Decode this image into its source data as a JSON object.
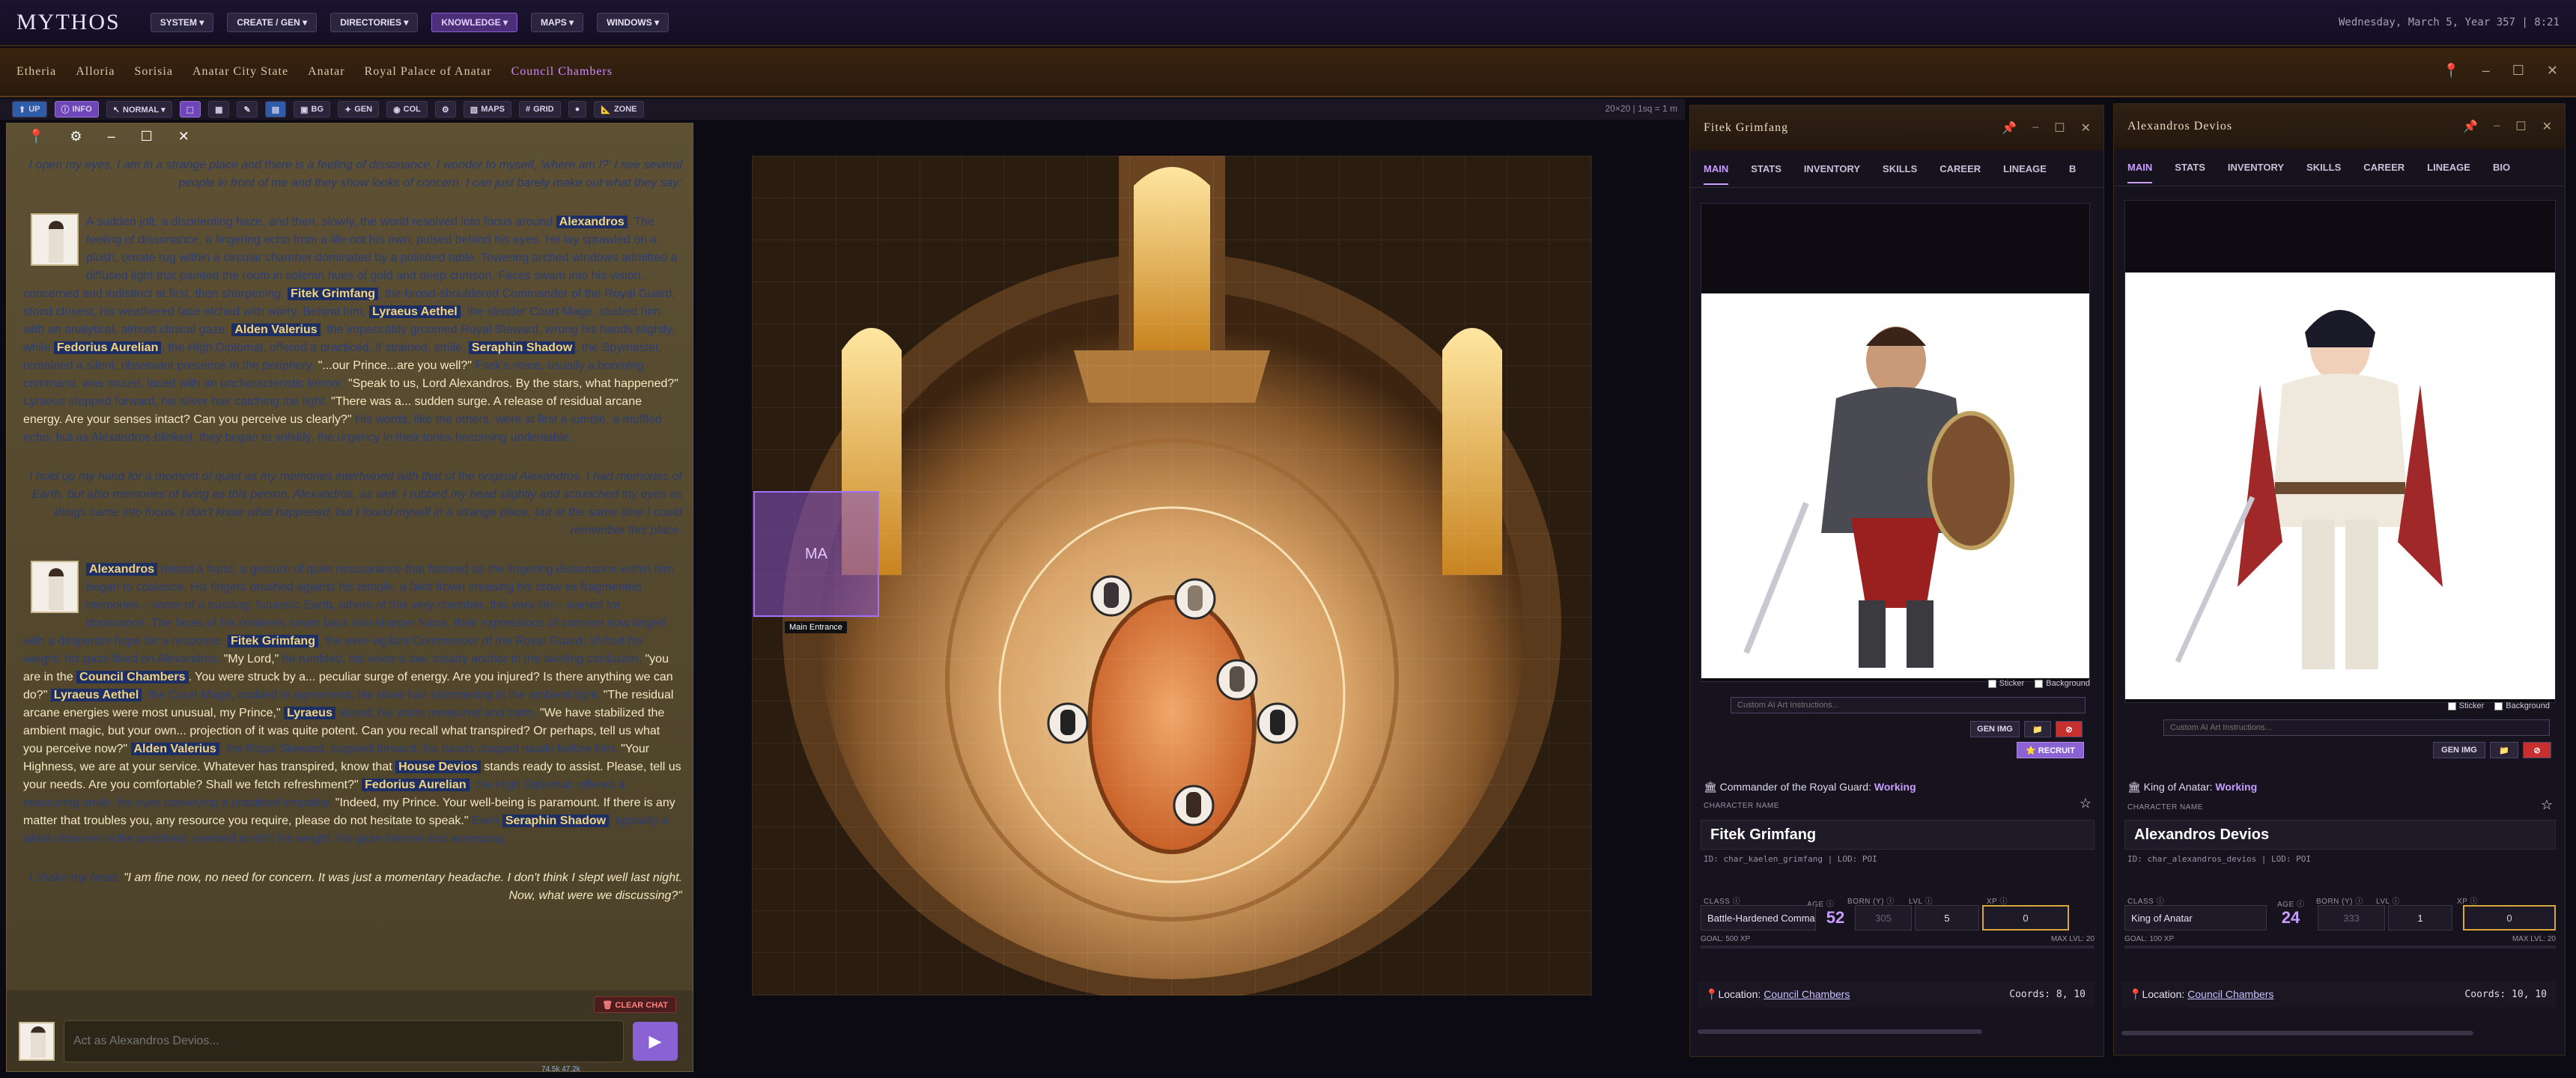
{
  "app": {
    "logo": "MYTHOS",
    "datetime": "Wednesday, March 5, Year 357 | 8:21"
  },
  "menu": [
    {
      "label": "SYSTEM ▾"
    },
    {
      "label": "CREATE / GEN ▾"
    },
    {
      "label": "DIRECTORIES ▾"
    },
    {
      "label": "KNOWLEDGE ▾"
    },
    {
      "label": "MAPS ▾"
    },
    {
      "label": "WINDOWS ▾"
    }
  ],
  "breadcrumb": [
    "Etheria",
    "Alloria",
    "Sorisia",
    "Anatar City State",
    "Anatar",
    "Royal Palace of Anatar",
    "Council Chambers"
  ],
  "toolbar": {
    "up": "UP",
    "info": "INFO",
    "mode": "NORMAL ▾",
    "bg": "BG",
    "gen": "GEN",
    "col": "COL",
    "maps": "MAPS",
    "grid": "GRID",
    "zone": "ZONE",
    "gridinfo": "20×20 | 1sq = 1 m"
  },
  "chat": {
    "narr1": "I open my eyes, I am in a strange place and there is a feeling of dissonance. I wonder to myself, 'where am I?' I see several people in front of me and they show looks of concern. I can just barely make out what they say:",
    "m1": {
      "t1": "A sudden jolt, a disorienting haze, and then, slowly, the world resolved into focus around ",
      "n1": "Alexandros",
      "t2": ". The feeling of dissonance, a lingering echo from a life not his own, pulsed behind his eyes. He lay sprawled on a plush, ornate rug within a circular chamber dominated by a polished table. Towering arched windows admitted a diffused light that painted the room in solemn hues of gold and deep crimson. Faces swam into his vision, concerned and indistinct at first, then sharpening. ",
      "n2": "Fitek Grimfang",
      "t3": ", the broad-shouldered Commander of the Royal Guard, stood closest, his weathered face etched with worry. Behind him, ",
      "n3": "Lyraeus Aethel",
      "t4": ", the slender Court Mage, studied him with an analytical, almost clinical gaze. ",
      "n4": "Alden Valerius",
      "t5": ", the impeccably groomed Royal Steward, wrung his hands slightly, while ",
      "n5": "Fedorius Aurelian",
      "t6": ", the High Diplomat, offered a practiced, if strained, smile. ",
      "n6": "Seraphin Shadow",
      "t7": ", the Spymaster, remained a silent, observant presence in the periphery. ",
      "q1": "\"...our Prince...are you well?\"",
      "t8": " Fitek's voice, usually a booming command, was muted, laced with an uncharacteristic tremor. ",
      "q2": "\"Speak to us, Lord Alexandros. By the stars, what happened?\"",
      "t9": " Lyraeus stepped forward, his silver hair catching the light. ",
      "q3": "\"There was a... sudden surge. A release of residual arcane energy. Are your senses intact? Can you perceive us clearly?\"",
      "t10": " His words, like the others, were at first a jumble, a muffled echo, but as Alexandros blinked, they began to solidify, the urgency in their tones becoming undeniable."
    },
    "narr2": "I hold up my hand for a moment of quiet as my memories intertwined with that of the original Alexandros. I had memories of Earth, but also memories of living as this person, Alexandros, as well. I rubbed my head slightly and scrunched my eyes as things came into focus. I don't know what happened, but I found myself in a strange place, but at the same time I could remember this place.",
    "m2": {
      "n1": "Alexandros",
      "t1": " raised a hand, a gesture of quiet reassurance that faltered as the lingering dissonance within him began to coalesce. His fingers brushed against his temple, a faint frown creasing his brow as fragmented memories – some of a bustling, futuristic Earth, others of this very chamber, this very life – warred for dominance. The faces of his retainers swam back into sharper focus, their expressions of concern now tinged with a desperate hope for a response. ",
      "n2": "Fitek Grimfang",
      "t2": ", the ever-vigilant Commander of the Royal Guard, shifted his weight, his gaze fixed on Alexandros. ",
      "q1": "\"My Lord,\"",
      "t3": " he rumbled, his voice a low, steady anchor in the swirling confusion, ",
      "q2": "\"you are in the ",
      "n3": "Council Chambers",
      "q3": ". You were struck by a... peculiar surge of energy. Are you injured? Is there anything we can do?\"",
      "t4": " ",
      "n4": "Lyraeus Aethel",
      "t5": ", the Court Mage, nodded in agreement, his silver hair shimmering in the ambient light. ",
      "q4": "\"The residual arcane energies were most unusual, my Prince,\"",
      "t6": " ",
      "n5": "Lyraeus",
      "t7": " stated, his voice measured and calm. ",
      "q5": "\"We have stabilized the ambient magic, but your own... projection of it was quite potent. Can you recall what transpired? Or perhaps, tell us what you perceive now?\"",
      "t8": " ",
      "n6": "Alden Valerius",
      "t9": ", the Royal Steward, stepped forward, his hands clasped neatly before him. ",
      "q6": "\"Your Highness, we are at your service. Whatever has transpired, know that ",
      "n7": "House Devios",
      "q7": " stands ready to assist. Please, tell us your needs. Are you comfortable? Shall we fetch refreshment?\"",
      "t10": " ",
      "n8": "Fedorius Aurelian",
      "t11": ", the High Diplomat, offered a reassuring smile, his eyes conveying a practiced empathy. ",
      "q8": "\"Indeed, my Prince. Your well-being is paramount. If there is any matter that troubles you, any resource you require, please do not hesitate to speak.\"",
      "t12": " Even ",
      "n9": "Seraphin Shadow",
      "t13": ", typically a silent observer in the periphery, seemed to shift his weight, his gaze intense and assessing."
    },
    "narr3a": "I shake my head, ",
    "narr3q": "\"I am fine now, no need for concern. It was just a momentary headache. I don't think I slept well last night. Now, what were we discussing?\"",
    "clear_label": "🗑 CLEAR CHAT",
    "input_placeholder": "Act as Alexandros Devios...",
    "send_label": "▶",
    "token_info": "74.5k   47.2k"
  },
  "map": {
    "zone_label": "MA",
    "zone_caption": "Main Entrance"
  },
  "panels": [
    {
      "title": "Fitek Grimfang",
      "tabs": [
        "MAIN",
        "STATS",
        "INVENTORY",
        "SKILLS",
        "CAREER",
        "LINEAGE",
        "B"
      ],
      "sticker": "Sticker",
      "background": "Background",
      "ai_placeholder": "Custom AI Art Instructions...",
      "gen_img": "GEN IMG",
      "folder": "📁",
      "delete": "⊘",
      "recruit": "⭐ RECRUIT",
      "role": "🏛 Commander of the Royal Guard: ",
      "status": "Working",
      "name_label": "CHARACTER NAME",
      "name": "Fitek Grimfang",
      "id_line": "ID: char_kaelen_grimfang | LOD: POI",
      "class_label": "CLASS ⓘ",
      "class": "Battle-Hardened Commander",
      "age_label": "AGE ⓘ",
      "age": "52",
      "born_label": "BORN (Y) ⓘ",
      "born": "305",
      "lvl_label": "LVL ⓘ",
      "lvl": "5",
      "xp_label": "XP ⓘ",
      "xp": "0",
      "goal": "GOAL: 500 XP",
      "maxlvl": "MAX LVL: 20",
      "loc_label": "Location:",
      "location": "Council Chambers",
      "coords": "Coords: 8, 10"
    },
    {
      "title": "Alexandros Devios",
      "tabs": [
        "MAIN",
        "STATS",
        "INVENTORY",
        "SKILLS",
        "CAREER",
        "LINEAGE",
        "BIO"
      ],
      "sticker": "Sticker",
      "background": "Background",
      "ai_placeholder": "Custom AI Art Instructions...",
      "gen_img": "GEN IMG",
      "folder": "📁",
      "delete": "⊘",
      "role": "🏛 King of Anatar: ",
      "status": "Working",
      "name_label": "CHARACTER NAME",
      "name": "Alexandros Devios",
      "id_line": "ID: char_alexandros_devios | LOD: POI",
      "class_label": "CLASS ⓘ",
      "class": "King of Anatar",
      "age_label": "AGE ⓘ",
      "age": "24",
      "born_label": "BORN (Y) ⓘ",
      "born": "333",
      "lvl_label": "LVL ⓘ",
      "lvl": "1",
      "xp_label": "XP ⓘ",
      "xp": "0",
      "goal": "GOAL: 100 XP",
      "maxlvl": "MAX LVL: 20",
      "loc_label": "Location:",
      "location": "Council Chambers",
      "coords": "Coords: 10, 10"
    }
  ]
}
